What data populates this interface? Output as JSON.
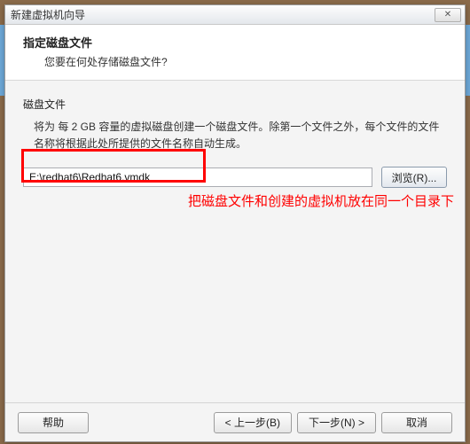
{
  "titlebar": {
    "text": "新建虚拟机向导",
    "close": "✕"
  },
  "header": {
    "title": "指定磁盘文件",
    "subtitle": "您要在何处存储磁盘文件?"
  },
  "body": {
    "section_label": "磁盘文件",
    "description": "将为 每 2 GB 容量的虚拟磁盘创建一个磁盘文件。除第一个文件之外，每个文件的文件名称将根据此处所提供的文件名称自动生成。",
    "path_value": "E:\\redhat6\\Redhat6.vmdk",
    "browse_label": "浏览(R)..."
  },
  "annotation": {
    "text": "把磁盘文件和创建的虚拟机放在同一个目录下"
  },
  "footer": {
    "help": "帮助",
    "back": "< 上一步(B)",
    "next": "下一步(N) >",
    "cancel": "取消"
  }
}
